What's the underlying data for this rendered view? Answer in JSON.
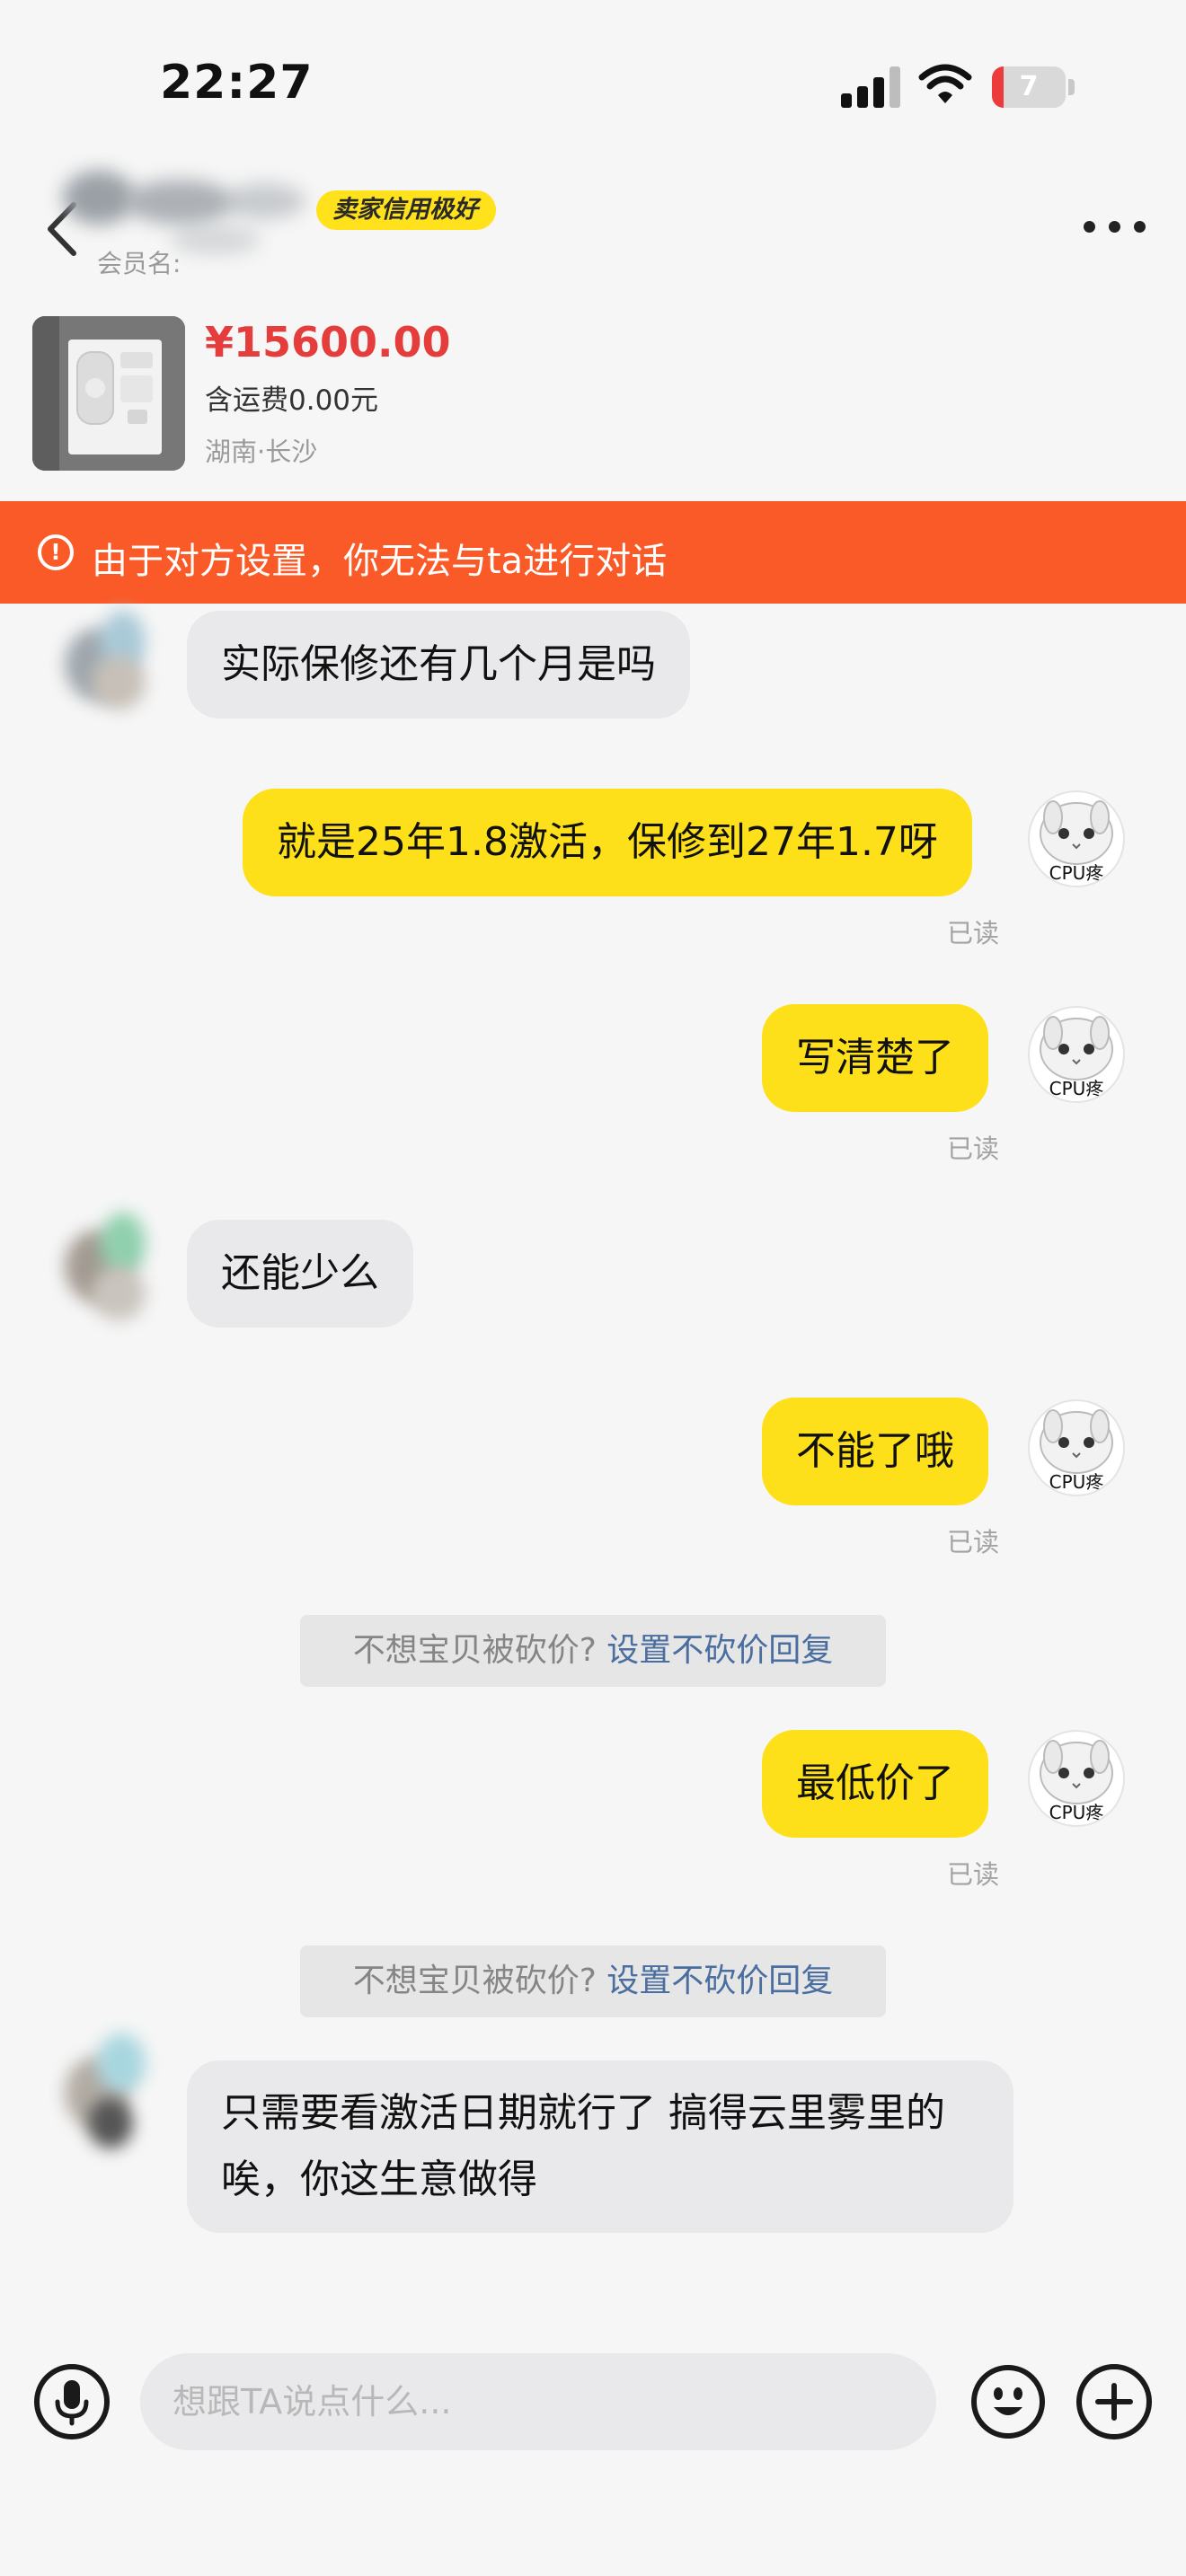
{
  "status_bar": {
    "time": "22:27",
    "battery": "7",
    "battery_level": 0.07
  },
  "header": {
    "credit_badge": "卖家信用极好",
    "member_label": "会员名:"
  },
  "product": {
    "price": "¥15600.00",
    "shipping": "含运费0.00元",
    "location": "湖南·长沙"
  },
  "warning": {
    "text": "由于对方设置，你无法与ta进行对话"
  },
  "messages": [
    {
      "side": "in",
      "text": "实际保修还有几个月是吗"
    },
    {
      "side": "out",
      "text": "就是25年1.8激活，保修到27年1.7呀",
      "read": "已读",
      "avatar_label": "CPU疼"
    },
    {
      "side": "out",
      "text": "写清楚了",
      "read": "已读",
      "avatar_label": "CPU疼"
    },
    {
      "side": "in",
      "text": "还能少么"
    },
    {
      "side": "out",
      "text": "不能了哦",
      "read": "已读",
      "avatar_label": "CPU疼"
    },
    {
      "side": "out",
      "text": "最低价了",
      "read": "已读",
      "avatar_label": "CPU疼"
    },
    {
      "side": "in",
      "text": "只需要看激活日期就行了 搞得云里雾里的 唉，你这生意做得"
    }
  ],
  "hint": {
    "question": "不想宝贝被砍价?",
    "link": "设置不砍价回复"
  },
  "input": {
    "placeholder": "想跟TA说点什么..."
  },
  "icons": {
    "back": "chevron-left-icon",
    "more": "more-dots-icon",
    "mic": "microphone-icon",
    "emoji": "smile-icon",
    "plus": "plus-icon",
    "warning": "alert-circle-icon"
  },
  "colors": {
    "accent_yellow": "#fde019",
    "warning_orange": "#fa5a27",
    "price_red": "#e53c3c",
    "link_blue": "#4a6ea0"
  }
}
